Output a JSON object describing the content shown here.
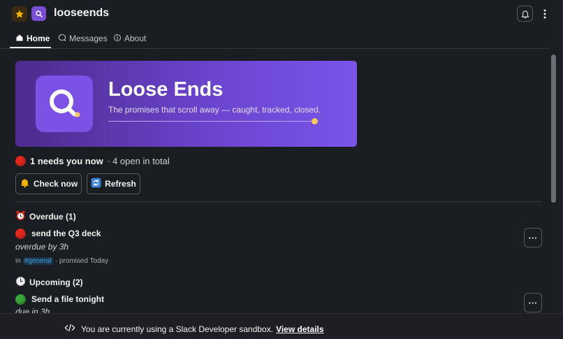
{
  "header": {
    "app_name": "looseends",
    "star_icon": "star-icon",
    "app_icon": "search-icon",
    "bell_icon": "bell-icon",
    "more_icon": "kebab-icon"
  },
  "tabs": [
    {
      "label": "Home",
      "icon": "home-icon",
      "active": true
    },
    {
      "label": "Messages",
      "icon": "message-icon",
      "active": false
    },
    {
      "label": "About",
      "icon": "info-icon",
      "active": false
    }
  ],
  "banner": {
    "title": "Loose Ends",
    "subtitle": "The promises that scroll away — caught, tracked, closed.",
    "accent": "#f7c85e"
  },
  "status": {
    "urgent": "1 needs you now",
    "separator": "·",
    "total": "4 open in total"
  },
  "buttons": {
    "check_now": "Check now",
    "refresh": "Refresh"
  },
  "sections": {
    "overdue": {
      "heading": "Overdue (1)",
      "item_title": "send the Q3 deck",
      "item_sub": "overdue by 3h",
      "meta_in": "in",
      "meta_channel": "#general",
      "meta_rest": "· promised Today"
    },
    "upcoming": {
      "heading": "Upcoming (2)",
      "item_title": "Send a file tonight",
      "item_sub": "due in 3h"
    }
  },
  "more_label": "···",
  "sandbox": {
    "message": "You are currently using a Slack Developer sandbox.",
    "link": "View details"
  }
}
